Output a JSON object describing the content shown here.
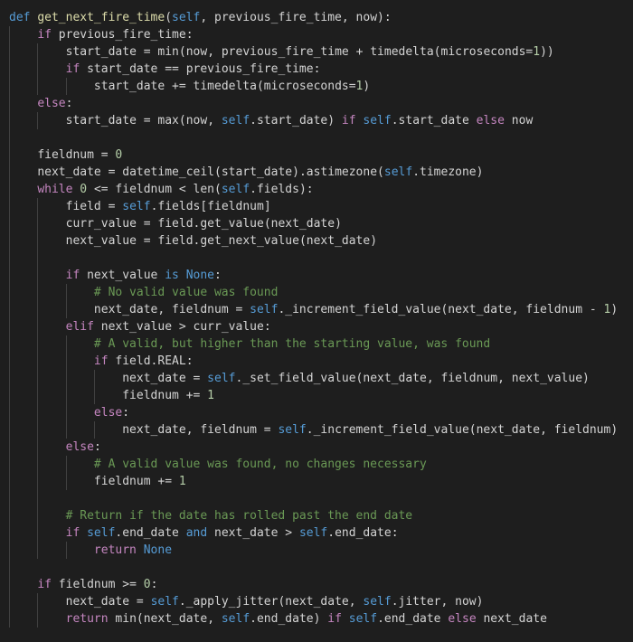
{
  "colors": {
    "background": "#1e1e1e",
    "text": "#d4d4d4",
    "keyword": "#569cd6",
    "control": "#c586c0",
    "function": "#dcdcaa",
    "number": "#b5cea8",
    "comment": "#6a9955"
  },
  "code": {
    "language": "python",
    "lines": [
      "def get_next_fire_time(self, previous_fire_time, now):",
      "    if previous_fire_time:",
      "        start_date = min(now, previous_fire_time + timedelta(microseconds=1))",
      "        if start_date == previous_fire_time:",
      "            start_date += timedelta(microseconds=1)",
      "    else:",
      "        start_date = max(now, self.start_date) if self.start_date else now",
      "",
      "    fieldnum = 0",
      "    next_date = datetime_ceil(start_date).astimezone(self.timezone)",
      "    while 0 <= fieldnum < len(self.fields):",
      "        field = self.fields[fieldnum]",
      "        curr_value = field.get_value(next_date)",
      "        next_value = field.get_next_value(next_date)",
      "",
      "        if next_value is None:",
      "            # No valid value was found",
      "            next_date, fieldnum = self._increment_field_value(next_date, fieldnum - 1)",
      "        elif next_value > curr_value:",
      "            # A valid, but higher than the starting value, was found",
      "            if field.REAL:",
      "                next_date = self._set_field_value(next_date, fieldnum, next_value)",
      "                fieldnum += 1",
      "            else:",
      "                next_date, fieldnum = self._increment_field_value(next_date, fieldnum)",
      "        else:",
      "            # A valid value was found, no changes necessary",
      "            fieldnum += 1",
      "",
      "        # Return if the date has rolled past the end date",
      "        if self.end_date and next_date > self.end_date:",
      "            return None",
      "",
      "    if fieldnum >= 0:",
      "        next_date = self._apply_jitter(next_date, self.jitter, now)",
      "        return min(next_date, self.end_date) if self.end_date else next_date"
    ]
  }
}
